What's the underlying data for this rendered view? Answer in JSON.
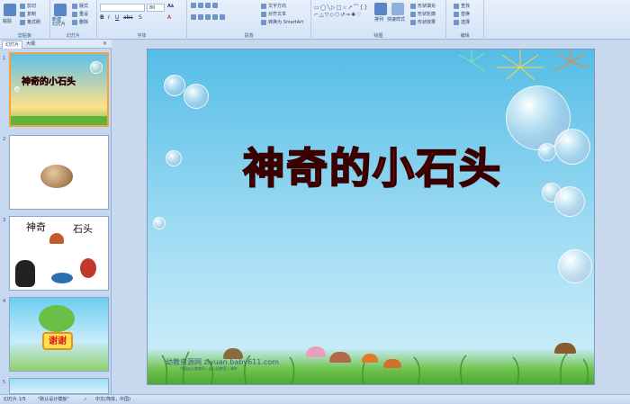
{
  "ribbon": {
    "clipboard": {
      "paste": "粘贴",
      "cut": "剪切",
      "copy": "复制",
      "format_painter": "格式刷",
      "label": "剪贴板"
    },
    "slides": {
      "new_slide": "新建\n幻灯片",
      "layout": "版式",
      "reset": "重设",
      "delete": "删除",
      "label": "幻灯片"
    },
    "font": {
      "font_name": "",
      "font_size": "80",
      "label": "字体"
    },
    "paragraph": {
      "text_direction": "文字方向",
      "align_text": "对齐文本",
      "smartart": "转换为 SmartArt",
      "label": "段落"
    },
    "drawing": {
      "arrange": "排列",
      "quick_styles": "快速样式",
      "shape_fill": "形状填充",
      "shape_outline": "形状轮廓",
      "shape_effects": "形状效果",
      "label": "绘图"
    },
    "editing": {
      "find": "查找",
      "replace": "替换",
      "select": "选择",
      "label": "编辑"
    }
  },
  "panel": {
    "tabs": [
      "幻灯片",
      "大纲"
    ],
    "thumbnails": [
      {
        "num": "1",
        "title": "神奇的小石头"
      },
      {
        "num": "2"
      },
      {
        "num": "3",
        "text_left": "神奇",
        "text_right": "石头"
      },
      {
        "num": "4",
        "text": "谢谢"
      },
      {
        "num": "5"
      }
    ]
  },
  "slide": {
    "title": "神奇的小石头",
    "watermark": "幼教资源网 ziyuan.baby611.com",
    "watermark_small": "中国幼儿教育网 | 幼儿园教案 | 课件"
  },
  "status": {
    "slide_info": "幻灯片 1/5",
    "theme": "\"默认设计模板\"",
    "language": "中文(简体，中国)"
  },
  "colors": {
    "title": "#ff2020",
    "ribbon": "#d4e3f6",
    "selection": "#f2a33a",
    "sky": "#55bde6"
  }
}
